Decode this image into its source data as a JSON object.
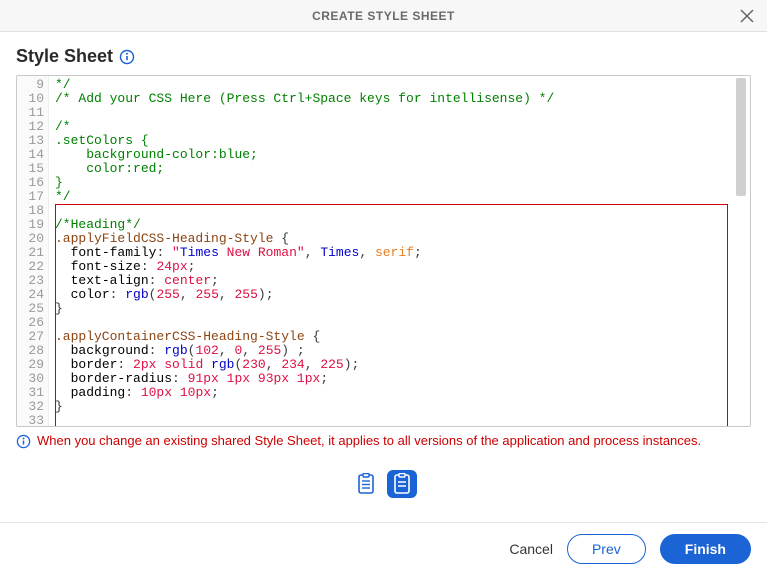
{
  "titlebar": {
    "title": "CREATE STYLE SHEET"
  },
  "section": {
    "title": "Style Sheet"
  },
  "editor": {
    "first_line_no": 9,
    "last_line_no": 33,
    "lines": [
      {
        "n": 9,
        "type": "comment",
        "text": "*/"
      },
      {
        "n": 10,
        "type": "comment",
        "text": "/* Add your CSS Here (Press Ctrl+Space keys for intellisense) */"
      },
      {
        "n": 11,
        "type": "blank",
        "text": ""
      },
      {
        "n": 12,
        "type": "comment",
        "text": "/*"
      },
      {
        "n": 13,
        "type": "comment",
        "text": ".setColors {"
      },
      {
        "n": 14,
        "type": "comment",
        "indent": 2,
        "text": "background-color:blue;"
      },
      {
        "n": 15,
        "type": "comment",
        "indent": 2,
        "text": "color:red;"
      },
      {
        "n": 16,
        "type": "comment",
        "text": "}"
      },
      {
        "n": 17,
        "type": "comment",
        "text": "*/"
      },
      {
        "n": 18,
        "type": "blank",
        "text": ""
      },
      {
        "n": 19,
        "type": "comment",
        "text": "/*Heading*/"
      },
      {
        "n": 20,
        "type": "selector",
        "text": ".applyFieldCSS-Heading-Style {"
      },
      {
        "n": 21,
        "type": "decl",
        "indent": 1,
        "prop": "font-family",
        "raw": "\"Times New Roman\", Times, serif;"
      },
      {
        "n": 22,
        "type": "decl",
        "indent": 1,
        "prop": "font-size",
        "raw": "24px;"
      },
      {
        "n": 23,
        "type": "decl",
        "indent": 1,
        "prop": "text-align",
        "raw": "center;"
      },
      {
        "n": 24,
        "type": "decl",
        "indent": 1,
        "prop": "color",
        "raw": "rgb(255, 255, 255);"
      },
      {
        "n": 25,
        "type": "brace",
        "text": "}"
      },
      {
        "n": 26,
        "type": "blank",
        "text": ""
      },
      {
        "n": 27,
        "type": "selector",
        "text": ".applyContainerCSS-Heading-Style {"
      },
      {
        "n": 28,
        "type": "decl",
        "indent": 1,
        "prop": "background",
        "raw": "rgb(102, 0, 255) ;"
      },
      {
        "n": 29,
        "type": "decl",
        "indent": 1,
        "prop": "border",
        "raw": "2px solid rgb(230, 234, 225);"
      },
      {
        "n": 30,
        "type": "decl",
        "indent": 1,
        "prop": "border-radius",
        "raw": "91px 1px 93px 1px;"
      },
      {
        "n": 31,
        "type": "decl",
        "indent": 1,
        "prop": "padding",
        "raw": "10px 10px;"
      },
      {
        "n": 32,
        "type": "brace",
        "text": "}"
      },
      {
        "n": 33,
        "type": "blank",
        "text": ""
      }
    ]
  },
  "warning": "When you change an existing shared Style Sheet, it applies to all versions of the application and process instances.",
  "footer": {
    "cancel": "Cancel",
    "prev": "Prev",
    "finish": "Finish"
  },
  "colors": {
    "accent": "#1a64d6",
    "danger": "#cc0000"
  }
}
